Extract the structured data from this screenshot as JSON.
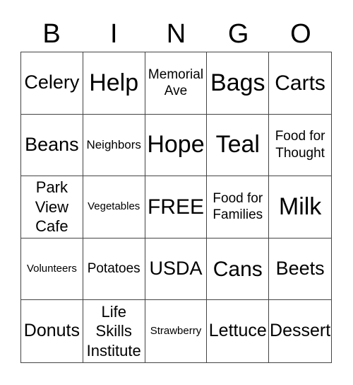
{
  "header": [
    "B",
    "I",
    "N",
    "G",
    "O"
  ],
  "cells": [
    "Celery",
    "Help",
    "Memorial Ave",
    "Bags",
    "Carts",
    "Beans",
    "Neighbors",
    "Hope",
    "Teal",
    "Food for Thought",
    "Park View Cafe",
    "Vegetables",
    "FREE",
    "Food for Families",
    "Milk",
    "Volunteers",
    "Potatoes",
    "USDA",
    "Cans",
    "Beets",
    "Donuts",
    "Life Skills Institute",
    "Strawberry",
    "Lettuce",
    "Dessert"
  ]
}
